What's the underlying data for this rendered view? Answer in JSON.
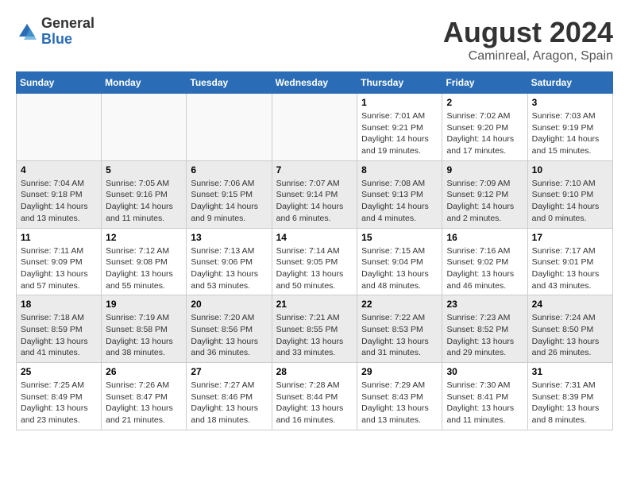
{
  "header": {
    "logo_general": "General",
    "logo_blue": "Blue",
    "month": "August 2024",
    "location": "Caminreal, Aragon, Spain"
  },
  "weekdays": [
    "Sunday",
    "Monday",
    "Tuesday",
    "Wednesday",
    "Thursday",
    "Friday",
    "Saturday"
  ],
  "weeks": [
    [
      {
        "day": "",
        "info": ""
      },
      {
        "day": "",
        "info": ""
      },
      {
        "day": "",
        "info": ""
      },
      {
        "day": "",
        "info": ""
      },
      {
        "day": "1",
        "info": "Sunrise: 7:01 AM\nSunset: 9:21 PM\nDaylight: 14 hours\nand 19 minutes."
      },
      {
        "day": "2",
        "info": "Sunrise: 7:02 AM\nSunset: 9:20 PM\nDaylight: 14 hours\nand 17 minutes."
      },
      {
        "day": "3",
        "info": "Sunrise: 7:03 AM\nSunset: 9:19 PM\nDaylight: 14 hours\nand 15 minutes."
      }
    ],
    [
      {
        "day": "4",
        "info": "Sunrise: 7:04 AM\nSunset: 9:18 PM\nDaylight: 14 hours\nand 13 minutes."
      },
      {
        "day": "5",
        "info": "Sunrise: 7:05 AM\nSunset: 9:16 PM\nDaylight: 14 hours\nand 11 minutes."
      },
      {
        "day": "6",
        "info": "Sunrise: 7:06 AM\nSunset: 9:15 PM\nDaylight: 14 hours\nand 9 minutes."
      },
      {
        "day": "7",
        "info": "Sunrise: 7:07 AM\nSunset: 9:14 PM\nDaylight: 14 hours\nand 6 minutes."
      },
      {
        "day": "8",
        "info": "Sunrise: 7:08 AM\nSunset: 9:13 PM\nDaylight: 14 hours\nand 4 minutes."
      },
      {
        "day": "9",
        "info": "Sunrise: 7:09 AM\nSunset: 9:12 PM\nDaylight: 14 hours\nand 2 minutes."
      },
      {
        "day": "10",
        "info": "Sunrise: 7:10 AM\nSunset: 9:10 PM\nDaylight: 14 hours\nand 0 minutes."
      }
    ],
    [
      {
        "day": "11",
        "info": "Sunrise: 7:11 AM\nSunset: 9:09 PM\nDaylight: 13 hours\nand 57 minutes."
      },
      {
        "day": "12",
        "info": "Sunrise: 7:12 AM\nSunset: 9:08 PM\nDaylight: 13 hours\nand 55 minutes."
      },
      {
        "day": "13",
        "info": "Sunrise: 7:13 AM\nSunset: 9:06 PM\nDaylight: 13 hours\nand 53 minutes."
      },
      {
        "day": "14",
        "info": "Sunrise: 7:14 AM\nSunset: 9:05 PM\nDaylight: 13 hours\nand 50 minutes."
      },
      {
        "day": "15",
        "info": "Sunrise: 7:15 AM\nSunset: 9:04 PM\nDaylight: 13 hours\nand 48 minutes."
      },
      {
        "day": "16",
        "info": "Sunrise: 7:16 AM\nSunset: 9:02 PM\nDaylight: 13 hours\nand 46 minutes."
      },
      {
        "day": "17",
        "info": "Sunrise: 7:17 AM\nSunset: 9:01 PM\nDaylight: 13 hours\nand 43 minutes."
      }
    ],
    [
      {
        "day": "18",
        "info": "Sunrise: 7:18 AM\nSunset: 8:59 PM\nDaylight: 13 hours\nand 41 minutes."
      },
      {
        "day": "19",
        "info": "Sunrise: 7:19 AM\nSunset: 8:58 PM\nDaylight: 13 hours\nand 38 minutes."
      },
      {
        "day": "20",
        "info": "Sunrise: 7:20 AM\nSunset: 8:56 PM\nDaylight: 13 hours\nand 36 minutes."
      },
      {
        "day": "21",
        "info": "Sunrise: 7:21 AM\nSunset: 8:55 PM\nDaylight: 13 hours\nand 33 minutes."
      },
      {
        "day": "22",
        "info": "Sunrise: 7:22 AM\nSunset: 8:53 PM\nDaylight: 13 hours\nand 31 minutes."
      },
      {
        "day": "23",
        "info": "Sunrise: 7:23 AM\nSunset: 8:52 PM\nDaylight: 13 hours\nand 29 minutes."
      },
      {
        "day": "24",
        "info": "Sunrise: 7:24 AM\nSunset: 8:50 PM\nDaylight: 13 hours\nand 26 minutes."
      }
    ],
    [
      {
        "day": "25",
        "info": "Sunrise: 7:25 AM\nSunset: 8:49 PM\nDaylight: 13 hours\nand 23 minutes."
      },
      {
        "day": "26",
        "info": "Sunrise: 7:26 AM\nSunset: 8:47 PM\nDaylight: 13 hours\nand 21 minutes."
      },
      {
        "day": "27",
        "info": "Sunrise: 7:27 AM\nSunset: 8:46 PM\nDaylight: 13 hours\nand 18 minutes."
      },
      {
        "day": "28",
        "info": "Sunrise: 7:28 AM\nSunset: 8:44 PM\nDaylight: 13 hours\nand 16 minutes."
      },
      {
        "day": "29",
        "info": "Sunrise: 7:29 AM\nSunset: 8:43 PM\nDaylight: 13 hours\nand 13 minutes."
      },
      {
        "day": "30",
        "info": "Sunrise: 7:30 AM\nSunset: 8:41 PM\nDaylight: 13 hours\nand 11 minutes."
      },
      {
        "day": "31",
        "info": "Sunrise: 7:31 AM\nSunset: 8:39 PM\nDaylight: 13 hours\nand 8 minutes."
      }
    ]
  ]
}
